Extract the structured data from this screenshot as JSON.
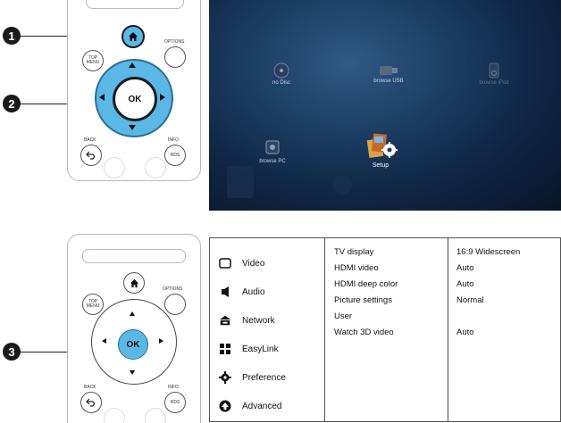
{
  "callouts": [
    "1",
    "2",
    "3"
  ],
  "remote_top": {
    "buttons": {
      "top_menu": "TOP MENU",
      "options": "OPTIONS",
      "ok": "OK",
      "back": "BACK",
      "info": "INFO",
      "rds": "RDS"
    },
    "colors": {
      "ring": "#5bb8e6",
      "ring_border": "#2c6f96",
      "home_accent": "#5bb8e6"
    }
  },
  "remote_bottom": {
    "buttons": {
      "top_menu": "TOP MENU",
      "options": "OPTIONS",
      "ok": "OK",
      "back": "BACK",
      "info": "INFO",
      "rds": "RDS"
    },
    "colors": {
      "ok_fill": "#5bb8e6"
    }
  },
  "home_screen": {
    "items": {
      "no_disc": "no Disc",
      "browse_usb": "browse USB",
      "browse_ipod": "browse iPod",
      "browse_pc": "browse PC",
      "setup": "Setup"
    }
  },
  "settings_menu": {
    "categories": [
      {
        "label": "Video",
        "icon": "video-icon"
      },
      {
        "label": "Audio",
        "icon": "speaker-icon"
      },
      {
        "label": "Network",
        "icon": "network-icon"
      },
      {
        "label": "EasyLink",
        "icon": "easylink-icon"
      },
      {
        "label": "Preference",
        "icon": "gear-icon"
      },
      {
        "label": "Advanced",
        "icon": "advanced-icon"
      }
    ],
    "settings": [
      {
        "name": "TV display",
        "value": "16:9 Widescreen"
      },
      {
        "name": "HDMI video",
        "value": "Auto"
      },
      {
        "name": "HDMI deep color",
        "value": "Auto"
      },
      {
        "name": "Picture settings",
        "value": "Normal"
      },
      {
        "name": "User",
        "value": ""
      },
      {
        "name": "Watch 3D video",
        "value": "Auto"
      }
    ]
  }
}
